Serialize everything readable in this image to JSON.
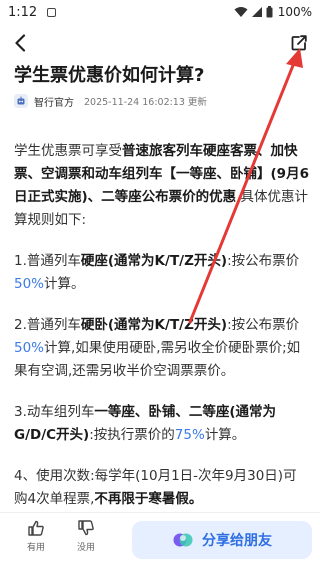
{
  "status_bar": {
    "time": "1:12",
    "battery": "100%"
  },
  "article": {
    "title": "学生票优惠价如何计算?",
    "author": "智行官方",
    "updated": "2025-11-24 16:02:13 更新"
  },
  "body": {
    "intro_1": "学生优惠票可享受",
    "intro_bold": "普速旅客列车硬座客票、加快票、空调票和动车组列车【一等座、卧铺】(9月6日正式实施)、二等座公布票价的优惠",
    "intro_2": ",具体优惠计算规则如下:",
    "r1_a": "1.普通列车",
    "r1_b": "硬座(通常为K/T/Z开头)",
    "r1_c": ":按公布票价",
    "r1_pct": "50%",
    "r1_d": "计算。",
    "r2_a": "2.普通列车",
    "r2_b": "硬卧(通常为K/T/Z开头)",
    "r2_c": ":按公布票价",
    "r2_pct": "50%",
    "r2_d": "计算,如果使用硬卧,需另收全价硬卧票价;如果有空调,还需另收半价空调票票价。",
    "r3_a": "3.动车组列车",
    "r3_b": "一等座、卧铺、二等座(通常为G/D/C开头)",
    "r3_c": ":按执行票价的",
    "r3_pct": "75%",
    "r3_d": "计算。",
    "r4_a": "4、使用次数:每学年(10月1日-次年9月30日)可购4次单程票,",
    "r4_b": "不再限于寒暑假。"
  },
  "bottom": {
    "useful_label": "有用",
    "useless_label": "没用",
    "share_label": "分享给朋友"
  },
  "colors": {
    "accent": "#3b7be8",
    "arrow": "#e53935",
    "share_bg": "#e5efff"
  }
}
